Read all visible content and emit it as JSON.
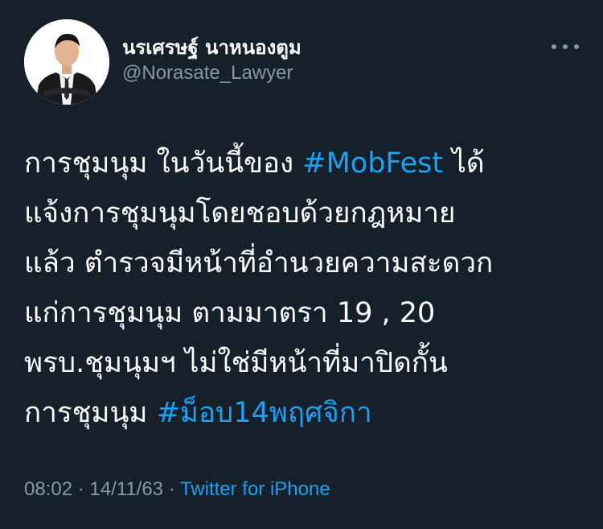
{
  "user": {
    "display_name": "นรเศรษฐ์ นาหนองตูม",
    "handle": "@Norasate_Lawyer"
  },
  "tweet": {
    "lines": [
      {
        "pre": "การชุมนุม ในวันนี้ของ ",
        "hashtag": "#MobFest",
        "post": " ได้"
      },
      {
        "pre": "แจ้งการชุมนุมโดยชอบด้วยกฎหมาย"
      },
      {
        "pre": "แล้ว ตำรวจมีหน้าที่อำนวยความสะดวก"
      },
      {
        "pre": "แก่การชุมนุม ตามมาตรา 19 , 20"
      },
      {
        "pre": "พรบ.ชุมนุมฯ ไม่ใช่มีหน้าที่มาปิดกั้น"
      },
      {
        "pre": "การชุมนุม ",
        "hashtag": "#ม็อบ14พฤศจิกา"
      }
    ]
  },
  "meta": {
    "time": "08:02",
    "sep1": " · ",
    "date": "14/11/63",
    "sep2": " · ",
    "source": "Twitter for iPhone"
  },
  "icons": {
    "more": "more-options-icon",
    "avatar": "profile-photo"
  },
  "colors": {
    "background": "#15202b",
    "text": "#ffffff",
    "secondary": "#8899a6",
    "link": "#1da1f2"
  }
}
